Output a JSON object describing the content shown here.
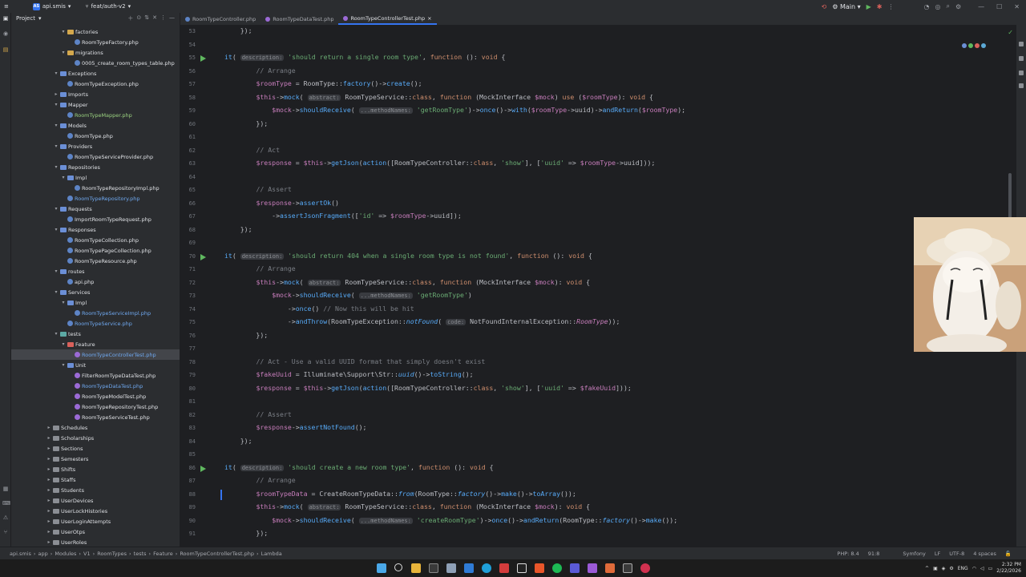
{
  "titlebar": {
    "project_badge": "AS",
    "project": "api.smis",
    "branch": "feat/auth-v2",
    "run_config": "Main"
  },
  "project_panel": {
    "title": "Project",
    "tree": [
      {
        "label": "factories",
        "kind": "folder",
        "color": "o",
        "depth": 3,
        "expanded": true
      },
      {
        "label": "RoomTypeFactory.php",
        "kind": "php",
        "depth": 4,
        "style": ""
      },
      {
        "label": "migrations",
        "kind": "folder",
        "color": "o",
        "depth": 3,
        "expanded": true
      },
      {
        "label": "0005_create_room_types_table.php",
        "kind": "php",
        "depth": 4,
        "style": ""
      },
      {
        "label": "Exceptions",
        "kind": "folder",
        "color": "b",
        "depth": 2,
        "expanded": true
      },
      {
        "label": "RoomTypeException.php",
        "kind": "php",
        "depth": 3,
        "style": ""
      },
      {
        "label": "Imports",
        "kind": "folder",
        "color": "b",
        "depth": 2,
        "expanded": false
      },
      {
        "label": "Mapper",
        "kind": "folder",
        "color": "b",
        "depth": 2,
        "expanded": true
      },
      {
        "label": "RoomTypeMapper.php",
        "kind": "php",
        "depth": 3,
        "style": "green"
      },
      {
        "label": "Models",
        "kind": "folder",
        "color": "b",
        "depth": 2,
        "expanded": true
      },
      {
        "label": "RoomType.php",
        "kind": "php",
        "depth": 3,
        "style": ""
      },
      {
        "label": "Providers",
        "kind": "folder",
        "color": "b",
        "depth": 2,
        "expanded": true
      },
      {
        "label": "RoomTypeServiceProvider.php",
        "kind": "php",
        "depth": 3,
        "style": ""
      },
      {
        "label": "Repositories",
        "kind": "folder",
        "color": "b",
        "depth": 2,
        "expanded": true
      },
      {
        "label": "Impl",
        "kind": "folder",
        "color": "b",
        "depth": 3,
        "expanded": true
      },
      {
        "label": "RoomTypeRepositoryImpl.php",
        "kind": "php",
        "depth": 4,
        "style": ""
      },
      {
        "label": "RoomTypeRepository.php",
        "kind": "php",
        "depth": 3,
        "style": "blue"
      },
      {
        "label": "Requests",
        "kind": "folder",
        "color": "b",
        "depth": 2,
        "expanded": true
      },
      {
        "label": "ImportRoomTypeRequest.php",
        "kind": "php",
        "depth": 3,
        "style": ""
      },
      {
        "label": "Responses",
        "kind": "folder",
        "color": "b",
        "depth": 2,
        "expanded": true
      },
      {
        "label": "RoomTypeCollection.php",
        "kind": "php",
        "depth": 3,
        "style": ""
      },
      {
        "label": "RoomTypePageCollection.php",
        "kind": "php",
        "depth": 3,
        "style": ""
      },
      {
        "label": "RoomTypeResource.php",
        "kind": "php",
        "depth": 3,
        "style": ""
      },
      {
        "label": "routes",
        "kind": "folder",
        "color": "b",
        "depth": 2,
        "expanded": true
      },
      {
        "label": "api.php",
        "kind": "php",
        "depth": 3,
        "style": ""
      },
      {
        "label": "Services",
        "kind": "folder",
        "color": "b",
        "depth": 2,
        "expanded": true
      },
      {
        "label": "Impl",
        "kind": "folder",
        "color": "b",
        "depth": 3,
        "expanded": true
      },
      {
        "label": "RoomTypeServiceImpl.php",
        "kind": "php",
        "depth": 4,
        "style": "blue"
      },
      {
        "label": "RoomTypeService.php",
        "kind": "php",
        "depth": 3,
        "style": "blue"
      },
      {
        "label": "tests",
        "kind": "folder",
        "color": "t",
        "depth": 2,
        "expanded": true
      },
      {
        "label": "Feature",
        "kind": "folder",
        "color": "r",
        "depth": 3,
        "expanded": true
      },
      {
        "label": "RoomTypeControllerTest.php",
        "kind": "phpt",
        "depth": 4,
        "style": "blue",
        "selected": true
      },
      {
        "label": "Unit",
        "kind": "folder",
        "color": "b",
        "depth": 3,
        "expanded": true
      },
      {
        "label": "FilterRoomTypeDataTest.php",
        "kind": "phpt",
        "depth": 4,
        "style": ""
      },
      {
        "label": "RoomTypeDataTest.php",
        "kind": "phpt",
        "depth": 4,
        "style": "blue"
      },
      {
        "label": "RoomTypeModelTest.php",
        "kind": "phpt",
        "depth": 4,
        "style": ""
      },
      {
        "label": "RoomTypeRepositoryTest.php",
        "kind": "phpt",
        "depth": 4,
        "style": ""
      },
      {
        "label": "RoomTypeServiceTest.php",
        "kind": "phpt",
        "depth": 4,
        "style": ""
      },
      {
        "label": "Schedules",
        "kind": "folder",
        "color": "g",
        "depth": 1,
        "expanded": false
      },
      {
        "label": "Scholarships",
        "kind": "folder",
        "color": "g",
        "depth": 1,
        "expanded": false
      },
      {
        "label": "Sections",
        "kind": "folder",
        "color": "g",
        "depth": 1,
        "expanded": false
      },
      {
        "label": "Semesters",
        "kind": "folder",
        "color": "g",
        "depth": 1,
        "expanded": false
      },
      {
        "label": "Shifts",
        "kind": "folder",
        "color": "g",
        "depth": 1,
        "expanded": false
      },
      {
        "label": "Staffs",
        "kind": "folder",
        "color": "g",
        "depth": 1,
        "expanded": false
      },
      {
        "label": "Students",
        "kind": "folder",
        "color": "g",
        "depth": 1,
        "expanded": false
      },
      {
        "label": "UserDevices",
        "kind": "folder",
        "color": "g",
        "depth": 1,
        "expanded": false
      },
      {
        "label": "UserLockHistories",
        "kind": "folder",
        "color": "g",
        "depth": 1,
        "expanded": false
      },
      {
        "label": "UserLoginAttempts",
        "kind": "folder",
        "color": "g",
        "depth": 1,
        "expanded": false
      },
      {
        "label": "UserOtps",
        "kind": "folder",
        "color": "g",
        "depth": 1,
        "expanded": false
      },
      {
        "label": "UserRoles",
        "kind": "folder",
        "color": "g",
        "depth": 1,
        "expanded": false
      }
    ]
  },
  "tabs": [
    {
      "label": "RoomTypeController.php",
      "active": false
    },
    {
      "label": "RoomTypeDataTest.php",
      "active": false
    },
    {
      "label": "RoomTypeControllerTest.php",
      "active": true
    }
  ],
  "code_lines": [
    {
      "n": "53",
      "html": "    });"
    },
    {
      "n": "54",
      "html": ""
    },
    {
      "n": "55",
      "run": true,
      "html": "<span class='fn'>it</span>( <span class='hint'>description:</span> <span class='str'>'should return a single room type'</span>, <span class='kw'>function</span> (): <span class='kw'>void</span> {"
    },
    {
      "n": "56",
      "html": "        <span class='cm'>// Arrange</span>"
    },
    {
      "n": "57",
      "html": "        <span class='var'>$roomType</span> = RoomType::<span class='fn'>factory</span>()-><span class='fn'>create</span>();"
    },
    {
      "n": "58",
      "html": "        <span class='var'>$this</span>-><span class='fn'>mock</span>( <span class='hint'>abstract:</span> RoomTypeService::<span class='kw'>class</span>, <span class='kw'>function</span> (MockInterface <span class='var'>$mock</span>) <span class='kw'>use</span> (<span class='var'>$roomType</span>): <span class='kw'>void</span> {"
    },
    {
      "n": "59",
      "html": "            <span class='var'>$mock</span>-><span class='fn'>shouldReceive</span>( <span class='hint'>...methodNames:</span> <span class='str'>'getRoomType'</span>)-><span class='fn'>once</span>()-><span class='fn'>with</span>(<span class='var'>$roomType</span>->uuid)-><span class='fn'>andReturn</span>(<span class='var'>$roomType</span>);"
    },
    {
      "n": "60",
      "html": "        });"
    },
    {
      "n": "61",
      "html": ""
    },
    {
      "n": "62",
      "html": "        <span class='cm'>// Act</span>"
    },
    {
      "n": "63",
      "html": "        <span class='var'>$response</span> = <span class='var'>$this</span>-><span class='fn'>getJson</span>(<span class='fn'>action</span>([RoomTypeController::<span class='kw'>class</span>, <span class='str'>'show'</span>], [<span class='str'>'uuid'</span> => <span class='var'>$roomType</span>->uuid]));"
    },
    {
      "n": "64",
      "html": ""
    },
    {
      "n": "65",
      "html": "        <span class='cm'>// Assert</span>"
    },
    {
      "n": "66",
      "html": "        <span class='var'>$response</span>-><span class='fn'>assertOk</span>()"
    },
    {
      "n": "67",
      "html": "            -><span class='fn'>assertJsonFragment</span>([<span class='str'>'id'</span> => <span class='var'>$roomType</span>->uuid]);"
    },
    {
      "n": "68",
      "html": "    });"
    },
    {
      "n": "69",
      "html": ""
    },
    {
      "n": "70",
      "run": true,
      "html": "<span class='fn'>it</span>( <span class='hint'>description:</span> <span class='str'>'should return 404 when a single room type is not found'</span>, <span class='kw'>function</span> (): <span class='kw'>void</span> {"
    },
    {
      "n": "71",
      "html": "        <span class='cm'>// Arrange</span>"
    },
    {
      "n": "72",
      "html": "        <span class='var'>$this</span>-><span class='fn'>mock</span>( <span class='hint'>abstract:</span> RoomTypeService::<span class='kw'>class</span>, <span class='kw'>function</span> (MockInterface <span class='var'>$mock</span>): <span class='kw'>void</span> {"
    },
    {
      "n": "73",
      "html": "            <span class='var'>$mock</span>-><span class='fn'>shouldReceive</span>( <span class='hint'>...methodNames:</span> <span class='str'>'getRoomType'</span>)"
    },
    {
      "n": "74",
      "html": "                -><span class='fn'>once</span>() <span class='cm'>// Now this will be hit</span>"
    },
    {
      "n": "75",
      "html": "                -><span class='fn'>andThrow</span>(RoomTypeException::<span class='fn it'>notFound</span>( <span class='hint'>code:</span> NotFoundInternalException::<span class='it var'>RoomType</span>));"
    },
    {
      "n": "76",
      "html": "        });"
    },
    {
      "n": "77",
      "html": ""
    },
    {
      "n": "78",
      "html": "        <span class='cm'>// Act - Use a valid UUID format that simply doesn't exist</span>"
    },
    {
      "n": "79",
      "html": "        <span class='var'>$fakeUuid</span> = Illuminate\\Support\\Str::<span class='fn it'>uuid</span>()-><span class='fn'>toString</span>();"
    },
    {
      "n": "80",
      "html": "        <span class='var'>$response</span> = <span class='var'>$this</span>-><span class='fn'>getJson</span>(<span class='fn'>action</span>([RoomTypeController::<span class='kw'>class</span>, <span class='str'>'show'</span>], [<span class='str'>'uuid'</span> => <span class='var'>$fakeUuid</span>]));"
    },
    {
      "n": "81",
      "html": ""
    },
    {
      "n": "82",
      "html": "        <span class='cm'>// Assert</span>"
    },
    {
      "n": "83",
      "html": "        <span class='var'>$response</span>-><span class='fn'>assertNotFound</span>();"
    },
    {
      "n": "84",
      "html": "    });"
    },
    {
      "n": "85",
      "html": ""
    },
    {
      "n": "86",
      "run": true,
      "html": "<span class='fn'>it</span>( <span class='hint'>description:</span> <span class='str'>'should create a new room type'</span>, <span class='kw'>function</span> (): <span class='kw'>void</span> {"
    },
    {
      "n": "87",
      "html": "        <span class='cm'>// Arrange</span>"
    },
    {
      "n": "88",
      "mod": true,
      "html": "        <span class='var'>$roomTypeData</span> = CreateRoomTypeData::<span class='fn it'>from</span>(RoomType::<span class='fn it'>factory</span>()-><span class='fn'>make</span>()-><span class='fn'>toArray</span>());"
    },
    {
      "n": "89",
      "html": "        <span class='var'>$this</span>-><span class='fn'>mock</span>( <span class='hint'>abstract:</span> RoomTypeService::<span class='kw'>class</span>, <span class='kw'>function</span> (MockInterface <span class='var'>$mock</span>): <span class='kw'>void</span> {"
    },
    {
      "n": "90",
      "html": "            <span class='var'>$mock</span>-><span class='fn'>shouldReceive</span>( <span class='hint'>...methodNames:</span> <span class='str'>'createRoomType'</span>)-><span class='fn'>once</span>()-><span class='fn'>andReturn</span>(RoomType::<span class='fn it'>factory</span>()-><span class='fn'>make</span>());"
    },
    {
      "n": "91",
      "html": "        });"
    }
  ],
  "statusbar": {
    "breadcrumbs": [
      "api.smis",
      "app",
      "Modules",
      "V1",
      "RoomTypes",
      "tests",
      "Feature",
      "RoomTypeControllerTest.php",
      "Lambda"
    ],
    "php": "PHP: 8.4",
    "position": "91:8",
    "framework": "Symfony",
    "line_sep": "LF",
    "encoding": "UTF-8",
    "indent": "4 spaces"
  },
  "taskbar": {
    "lang": "ENG",
    "time": "2:32 PM",
    "date": "2/22/2026"
  }
}
